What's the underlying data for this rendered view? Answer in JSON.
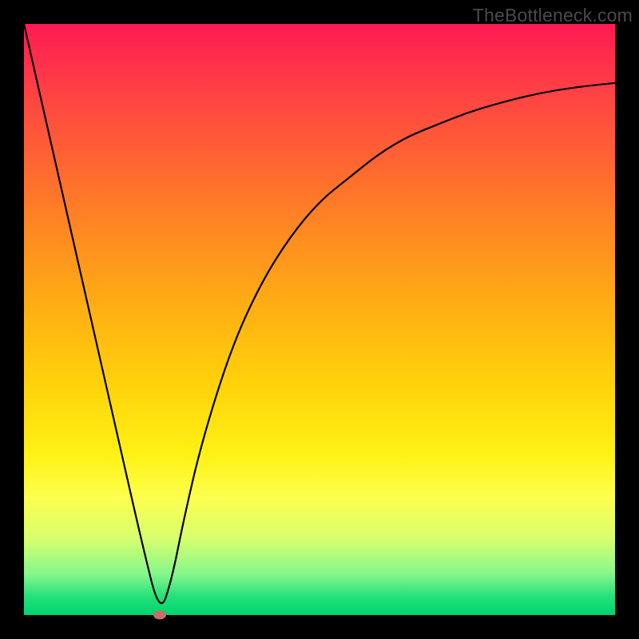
{
  "watermark": "TheBottleneck.com",
  "chart_data": {
    "type": "line",
    "title": "",
    "xlabel": "",
    "ylabel": "",
    "xlim": [
      0,
      100
    ],
    "ylim": [
      0,
      100
    ],
    "grid": false,
    "legend": false,
    "series": [
      {
        "name": "bottleneck-curve",
        "x": [
          0,
          5,
          10,
          15,
          20,
          23,
          25,
          27,
          30,
          35,
          40,
          45,
          50,
          55,
          60,
          65,
          70,
          75,
          80,
          85,
          90,
          95,
          100
        ],
        "values": [
          100,
          78,
          56,
          34,
          12,
          0,
          6,
          16,
          29,
          45,
          56,
          64,
          70,
          74,
          78,
          81,
          83,
          85,
          86.5,
          87.8,
          88.8,
          89.5,
          90
        ]
      }
    ],
    "marker": {
      "x": 23,
      "y": 0
    },
    "background_gradient": {
      "top": "#ff1a53",
      "bottom": "#00d46e",
      "meaning": "red=high bottleneck, green=low bottleneck"
    }
  }
}
